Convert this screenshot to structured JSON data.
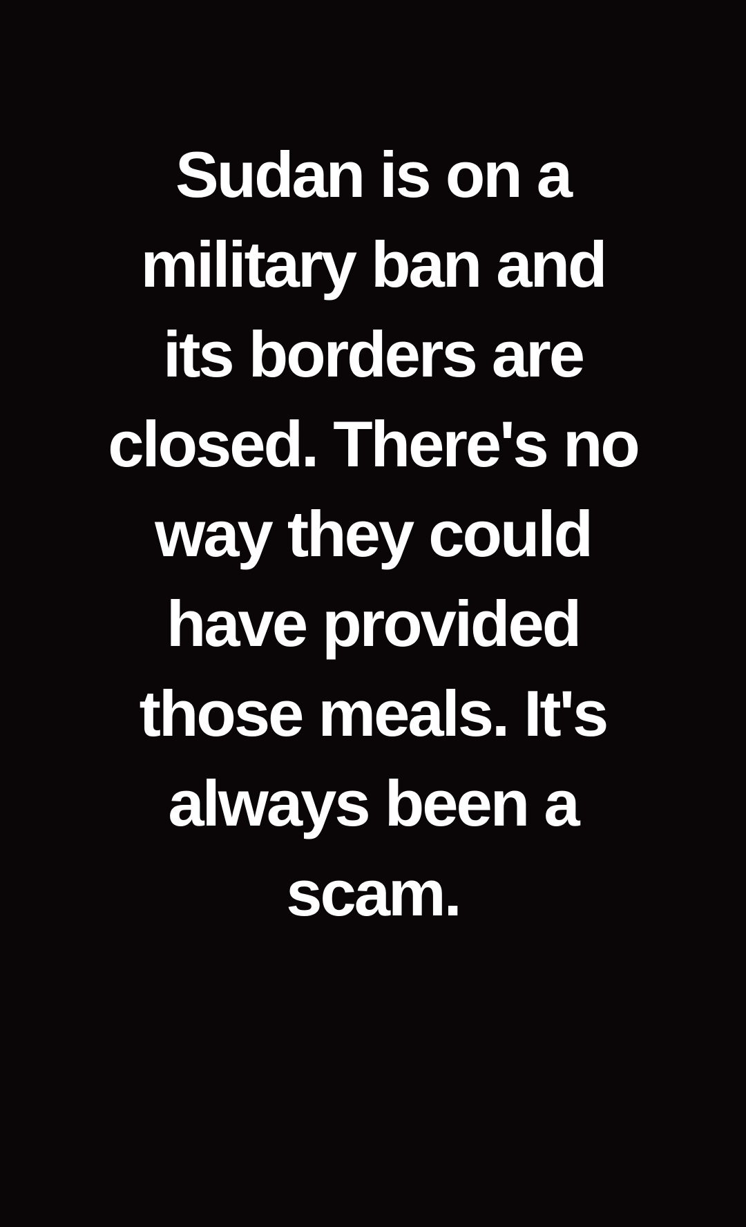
{
  "post": {
    "background_color": "#0a0608",
    "text_color": "#ffffff",
    "lines": [
      "Sudan is on a",
      "military ban and",
      "its borders are",
      "closed. There's no",
      "way they could",
      "have provided",
      "those meals. It's",
      "always been a",
      "scam."
    ]
  }
}
